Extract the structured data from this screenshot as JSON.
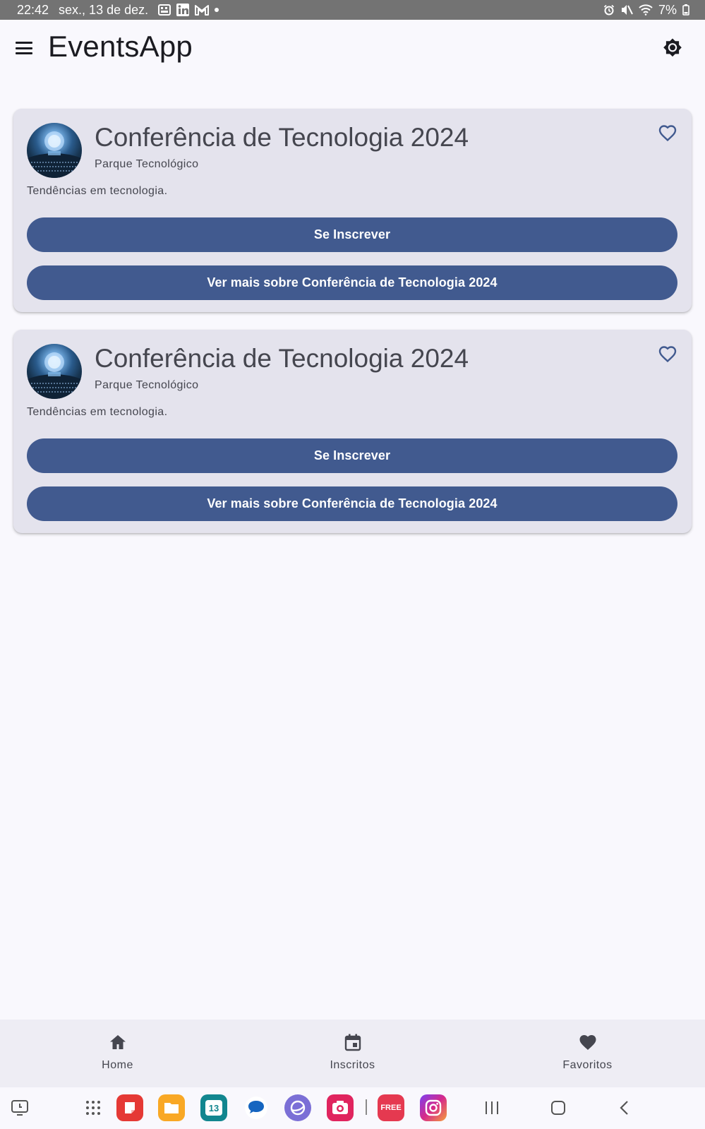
{
  "status_bar": {
    "time": "22:42",
    "date": "sex., 13 de dez.",
    "battery": "7%",
    "notification_icons": [
      "keyboard-icon",
      "linkedin-icon",
      "gmail-icon",
      "dot-icon"
    ],
    "status_icons": [
      "alarm-icon",
      "mute-icon",
      "wifi-icon",
      "battery-icon"
    ]
  },
  "app_bar": {
    "title": "EventsApp",
    "menu_icon": "menu-icon",
    "theme_icon": "brightness-icon"
  },
  "events": [
    {
      "title": "Conferência de Tecnologia 2024",
      "location": "Parque Tecnológico",
      "description": "Tendências em tecnologia.",
      "subscribe_label": "Se Inscrever",
      "more_label": "Ver mais sobre Conferência de Tecnologia 2024",
      "favorite": false
    },
    {
      "title": "Conferência de Tecnologia 2024",
      "location": "Parque Tecnológico",
      "description": "Tendências em tecnologia.",
      "subscribe_label": "Se Inscrever",
      "more_label": "Ver mais sobre Conferência de Tecnologia 2024",
      "favorite": false
    }
  ],
  "bottom_nav": {
    "items": [
      {
        "label": "Home",
        "icon": "home-icon"
      },
      {
        "label": "Inscritos",
        "icon": "calendar-icon"
      },
      {
        "label": "Favoritos",
        "icon": "heart-icon"
      }
    ]
  },
  "taskbar": {
    "calendar_day": "13",
    "free_label": "FREE",
    "apps": [
      "screen-recorder-icon",
      "app-drawer-icon",
      "notes-app-icon",
      "files-app-icon",
      "calendar-app-icon",
      "messages-app-icon",
      "browser-app-icon",
      "camera-app-icon",
      "free-app-icon",
      "instagram-app-icon"
    ],
    "nav_buttons": [
      "recents-icon",
      "home-button-icon",
      "back-icon"
    ]
  },
  "colors": {
    "primary": "#415a8f",
    "card_bg": "#e4e3ed",
    "background": "#f9f8fd",
    "status_bar": "#737373"
  }
}
